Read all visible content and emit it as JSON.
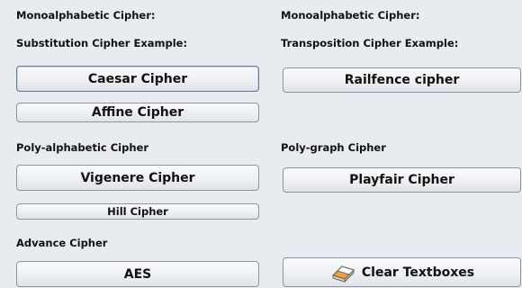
{
  "left": {
    "mono_label": "Monoalphabetic Cipher:",
    "subst_label": "Substitution Cipher Example:",
    "caesar": "Caesar Cipher",
    "affine": "Affine Cipher",
    "poly_label": "Poly-alphabetic Cipher",
    "vigenere": "Vigenere Cipher",
    "hill": "Hill Cipher",
    "advance_label": "Advance Cipher",
    "aes": "AES"
  },
  "right": {
    "mono_label": "Monoalphabetic Cipher:",
    "trans_label": "Transposition Cipher Example:",
    "railfence": "Railfence cipher",
    "polygraph_label": "Poly-graph Cipher",
    "playfair": "Playfair Cipher",
    "clear": "Clear Textboxes"
  },
  "icons": {
    "clear": "eraser-icon"
  }
}
